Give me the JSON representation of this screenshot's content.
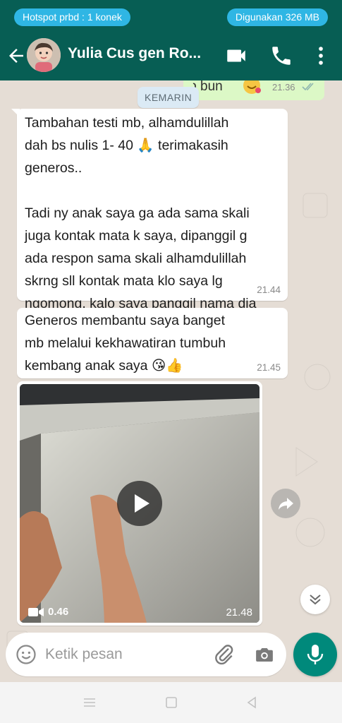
{
  "status_bar": {
    "hotspot": "Hotspot prbd : 1 konek",
    "data_usage": "Digunakan 326 MB"
  },
  "header": {
    "contact_name": "Yulia Cus gen Ro...",
    "icons": [
      "back-arrow-icon",
      "video-call-icon",
      "phone-icon",
      "more-vert-icon"
    ]
  },
  "chat": {
    "prev_outgoing": {
      "text": "Pkp bun",
      "time": "21.36"
    },
    "date_divider": "KEMARIN",
    "messages": [
      {
        "text": "Tambahan testi mb, alhamdulillah\ndah bs nulis 1- 40 🙏 terimakasih\ngeneros..\n\nTadi ny anak saya ga ada sama skali\njuga kontak mata k saya, dipanggil g\nada respon sama skali alhamdulillah\nskrng sll kontak mata klo saya lg\nngomong, kalo saya panggil nama dia\nnengok",
        "time": "21.44"
      },
      {
        "text": "Generos membantu saya banget\nmb melalui kekhawatiran tumbuh\nkembang anak saya 😘👍",
        "time": "21.45"
      }
    ],
    "video": {
      "duration": "0.46",
      "time": "21.48"
    }
  },
  "input": {
    "placeholder": "Ketik pesan"
  },
  "colors": {
    "header": "#075e54",
    "chat_bg": "#e5ddd5",
    "outgoing": "#dcf8c6",
    "accent": "#00897b",
    "pill": "#2fb6e4"
  }
}
